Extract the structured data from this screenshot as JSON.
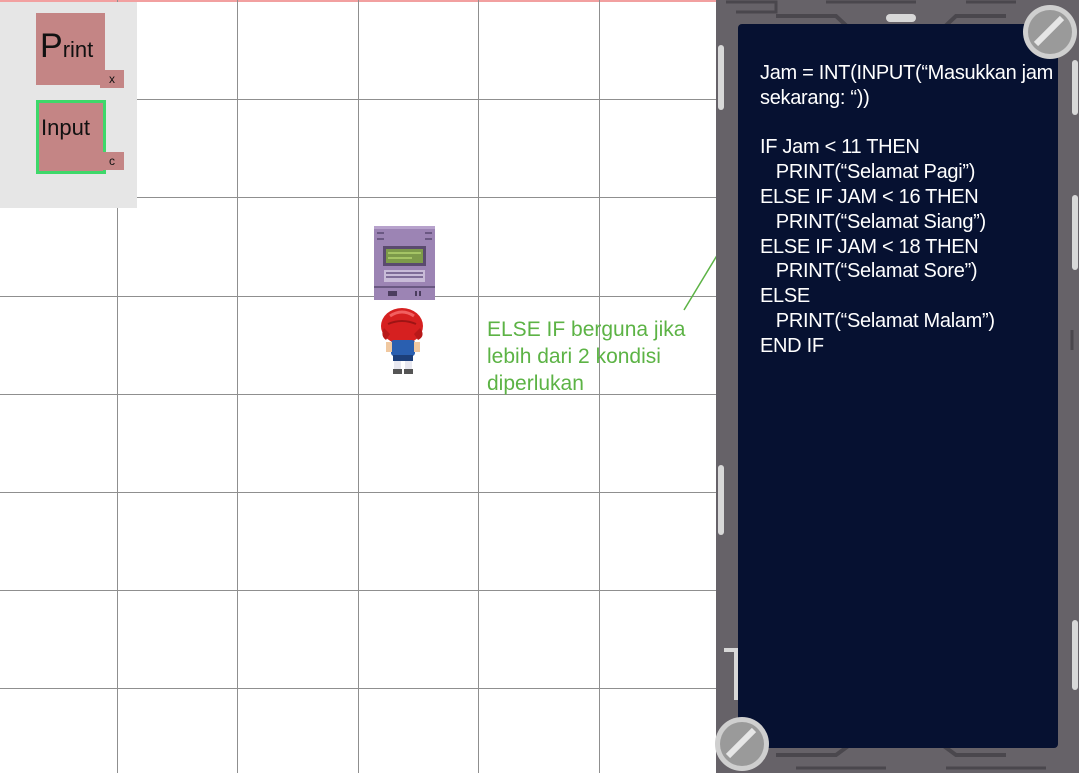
{
  "commands": {
    "print": {
      "label_initial": "P",
      "label_rest": "rint",
      "key": "x"
    },
    "input": {
      "label": "Input",
      "key": "c",
      "selected": true
    }
  },
  "hint": {
    "text": "ELSE IF berguna jika lebih dari 2 kondisi diperlukan",
    "color": "#5cb345"
  },
  "code": {
    "lines": [
      "Jam = INT(INPUT(“Masukkan jam sekarang: “))",
      "",
      "IF Jam < 11 THEN",
      "   PRINT(“Selamat Pagi”)",
      "ELSE IF JAM < 16 THEN",
      "   PRINT(“Selamat Siang”)",
      "ELSE IF JAM < 18 THEN",
      "   PRINT(“Selamat Sore”)",
      "ELSE",
      "   PRINT(“Selamat Malam”)",
      "END IF"
    ]
  },
  "colors": {
    "grid_line": "#8f8f8f",
    "command_block": "#c48585",
    "selected_outline": "#3ed86a",
    "code_background": "#061131",
    "frame": "#666268"
  },
  "icons": {
    "machine": "computer-terminal-icon",
    "character": "player-character-icon",
    "screw": "screw-icon"
  }
}
